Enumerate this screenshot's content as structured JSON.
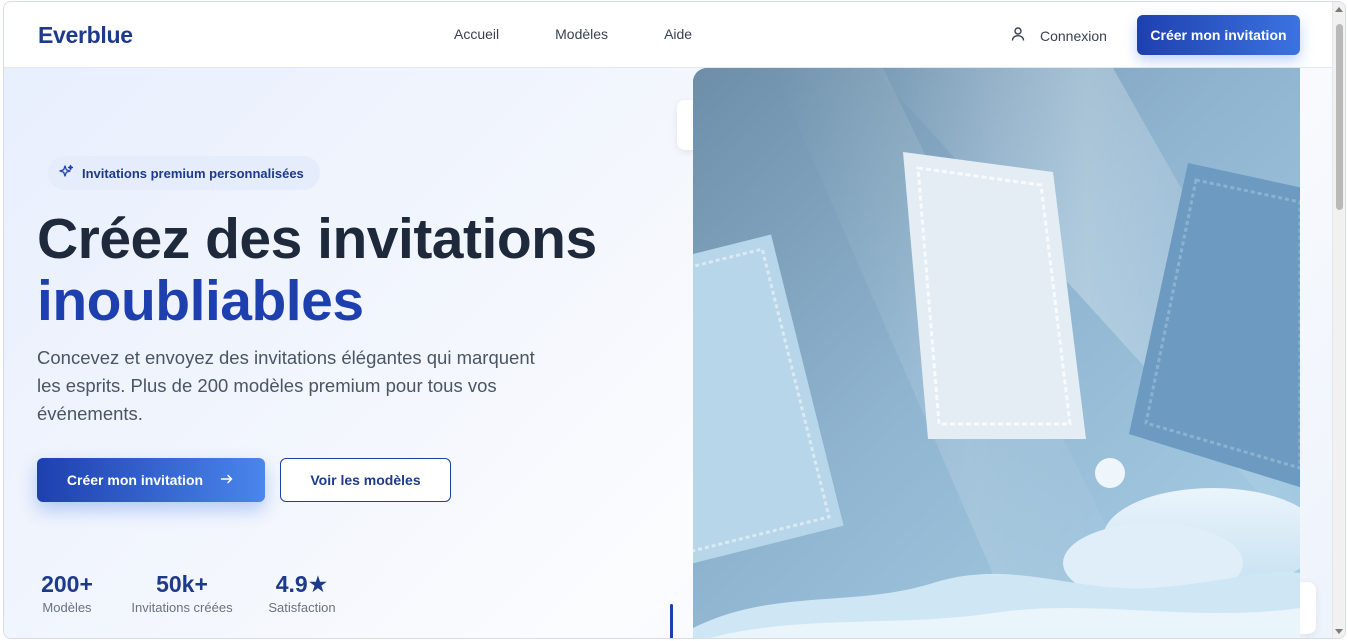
{
  "header": {
    "logo": "Everblue",
    "nav": [
      "Accueil",
      "Modèles",
      "Aide"
    ],
    "login_label": "Connexion",
    "cta_label": "Créer mon invitation"
  },
  "hero": {
    "badge": "Invitations premium personnalisées",
    "title_line1": "Créez des invitations",
    "title_line2": "inoubliables",
    "lead": "Concevez et envoyez des invitations élégantes qui marquent les esprits. Plus de 200 modèles premium pour tous vos événements.",
    "primary_button": "Créer mon invitation",
    "secondary_button": "Voir les modèles",
    "stats": [
      {
        "value": "200+",
        "label": "Modèles"
      },
      {
        "value": "50k+",
        "label": "Invitations créées"
      },
      {
        "value": "4.9★",
        "label": "Satisfaction"
      }
    ]
  },
  "colors": {
    "brand": "#1e40af",
    "brand_dark": "#1e3a8a",
    "text": "#1e293b",
    "muted": "#4b5563"
  },
  "icons": {
    "login": "user-icon",
    "badge": "sparkles-icon",
    "primary_button": "arrow-right-icon"
  }
}
